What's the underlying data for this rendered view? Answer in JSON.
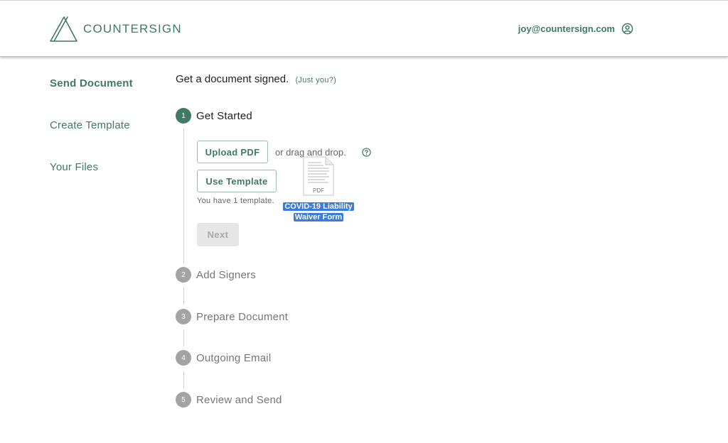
{
  "app": {
    "name": "COUNTERSIGN"
  },
  "header": {
    "user_email": "joy@countersign.com"
  },
  "sidebar": {
    "items": [
      {
        "label": "Send Document"
      },
      {
        "label": "Create Template"
      },
      {
        "label": "Your Files"
      }
    ]
  },
  "main": {
    "heading": "Get a document signed.",
    "just_you": "(Just you?)",
    "steps": [
      {
        "number": "1",
        "label": "Get Started"
      },
      {
        "number": "2",
        "label": "Add Signers"
      },
      {
        "number": "3",
        "label": "Prepare Document"
      },
      {
        "number": "4",
        "label": "Outgoing Email"
      },
      {
        "number": "5",
        "label": "Review and Send"
      }
    ],
    "upload_label": "Upload PDF",
    "drag_text": "or drag and drop.",
    "use_template_label": "Use Template",
    "template_count": "You have 1 template.",
    "next_label": "Next"
  },
  "drag_file": {
    "type_label": "PDF",
    "name_line1": "COVID-19 Liability",
    "name_line2": "Waiver Form"
  },
  "colors": {
    "accent": "#3f7a62",
    "drag_highlight": "#3d7bd9",
    "step_inactive": "#a3a3a3"
  }
}
